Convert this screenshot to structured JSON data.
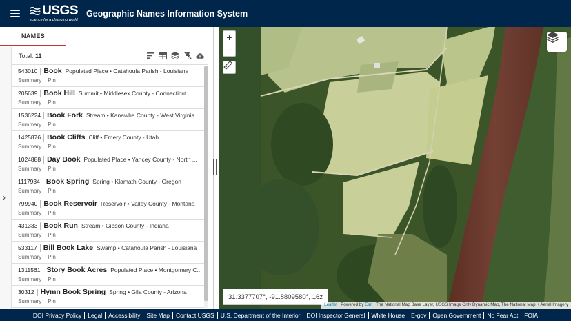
{
  "header": {
    "logo_text": "USGS",
    "logo_tagline": "science for a changing world",
    "title": "Geographic Names Information System"
  },
  "left_panel": {
    "tab_label": "NAMES",
    "total_label": "Total:",
    "total_count": "11",
    "toolbar_icons": [
      "sort-icon",
      "table-icon",
      "layers-icon",
      "pin-off-icon",
      "cloud-download-icon"
    ],
    "results": [
      {
        "id": "543010",
        "name": "Book",
        "desc": "Populated Place • Catahoula Parish - Louisiana",
        "summary": "Summary",
        "pin": "Pin"
      },
      {
        "id": "205639",
        "name": "Book Hill",
        "desc": "Summit • Middlesex County - Connecticut",
        "summary": "Summary",
        "pin": "Pin"
      },
      {
        "id": "1536224",
        "name": "Book Fork",
        "desc": "Stream • Kanawha County - West Virginia",
        "summary": "Summary",
        "pin": "Pin"
      },
      {
        "id": "1425876",
        "name": "Book Cliffs",
        "desc": "Cliff • Emery County - Utah",
        "summary": "Summary",
        "pin": "Pin"
      },
      {
        "id": "1024888",
        "name": "Day Book",
        "desc": "Populated Place • Yancey County - North ...",
        "summary": "Summary",
        "pin": "Pin"
      },
      {
        "id": "1117934",
        "name": "Book Spring",
        "desc": "Spring • Klamath County - Oregon",
        "summary": "Summary",
        "pin": "Pin"
      },
      {
        "id": "799940",
        "name": "Book Reservoir",
        "desc": "Reservoir • Valley County - Montana",
        "summary": "Summary",
        "pin": "Pin"
      },
      {
        "id": "431333",
        "name": "Book Run",
        "desc": "Stream • Gibson County - Indiana",
        "summary": "Summary",
        "pin": "Pin"
      },
      {
        "id": "533117",
        "name": "Bill Book Lake",
        "desc": "Swamp • Catahoula Parish - Louisiana",
        "summary": "Summary",
        "pin": "Pin"
      },
      {
        "id": "1311561",
        "name": "Story Book Acres",
        "desc": "Populated Place • Montgomery C...",
        "summary": "Summary",
        "pin": "Pin"
      },
      {
        "id": "30312",
        "name": "Hymn Book Spring",
        "desc": "Spring • Gila County - Arizona",
        "summary": "Summary",
        "pin": "Pin"
      }
    ]
  },
  "map": {
    "zoom_in": "+",
    "zoom_out": "−",
    "coordinates": "31.3377707°, -91.8809580°, 16z",
    "attribution_leaflet": "Leaflet",
    "attribution_sep": " | Powered by ",
    "attribution_esri": "Esri",
    "attribution_rest": " | The National Map Base Layer, USGS Image Only Dynamic Map, The National Map + Aerial Imagery"
  },
  "footer": {
    "links": [
      "DOI Privacy Policy",
      "Legal",
      "Accessibility",
      "Site Map",
      "Contact USGS",
      "U.S. Department of the Interior",
      "DOI Inspector General",
      "White House",
      "E-gov",
      "Open Government",
      "No Fear Act",
      "FOIA"
    ]
  },
  "colors": {
    "header_bg": "#00264c",
    "tab_accent": "#c0392b",
    "link_blue": "#0079c1"
  }
}
